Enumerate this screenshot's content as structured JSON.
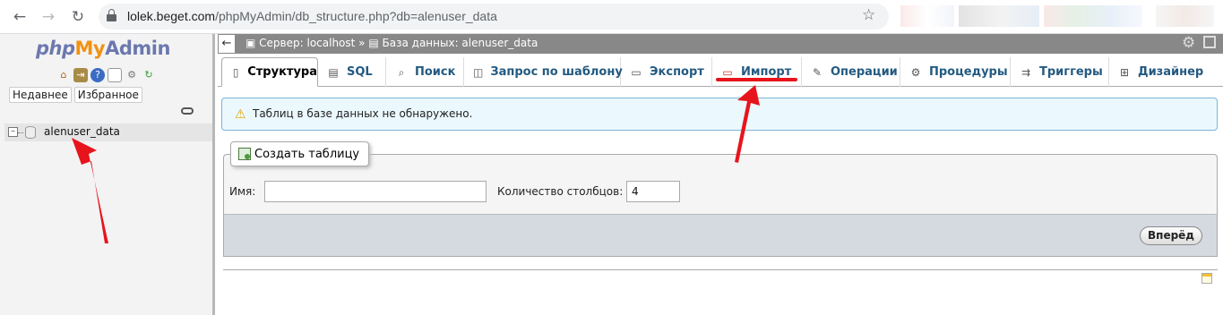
{
  "browser": {
    "url_host": "lolek.beget.com",
    "url_path": "/phpMyAdmin/db_structure.php?db=alenuser_data"
  },
  "sidebar": {
    "logo_php": "php",
    "logo_my": "My",
    "logo_admin": "Admin",
    "tabs": [
      "Недавнее",
      "Избранное"
    ],
    "database": "alenuser_data"
  },
  "breadcrumb": {
    "server": "Сервер: localhost »",
    "database": "База данных: alenuser_data"
  },
  "tabs": [
    {
      "label": "Структура",
      "icon": "structure-icon"
    },
    {
      "label": "SQL",
      "icon": "sql-icon"
    },
    {
      "label": "Поиск",
      "icon": "search-icon"
    },
    {
      "label": "Запрос по шаблону",
      "icon": "query-icon"
    },
    {
      "label": "Экспорт",
      "icon": "export-icon"
    },
    {
      "label": "Импорт",
      "icon": "import-icon"
    },
    {
      "label": "Операции",
      "icon": "wrench-icon"
    },
    {
      "label": "Процедуры",
      "icon": "routines-icon"
    },
    {
      "label": "Триггеры",
      "icon": "triggers-icon"
    },
    {
      "label": "Дизайнер",
      "icon": "designer-icon"
    }
  ],
  "notice": "Таблиц в базе данных не обнаружено.",
  "create": {
    "legend": "Создать таблицу",
    "name_label": "Имя:",
    "name_value": "",
    "cols_label": "Количество столбцов:",
    "cols_value": "4",
    "go": "Вперёд"
  },
  "colors": {
    "tab_text": "#235a81",
    "notice_bg": "#ebf8fd",
    "arrow": "#e8141c"
  }
}
